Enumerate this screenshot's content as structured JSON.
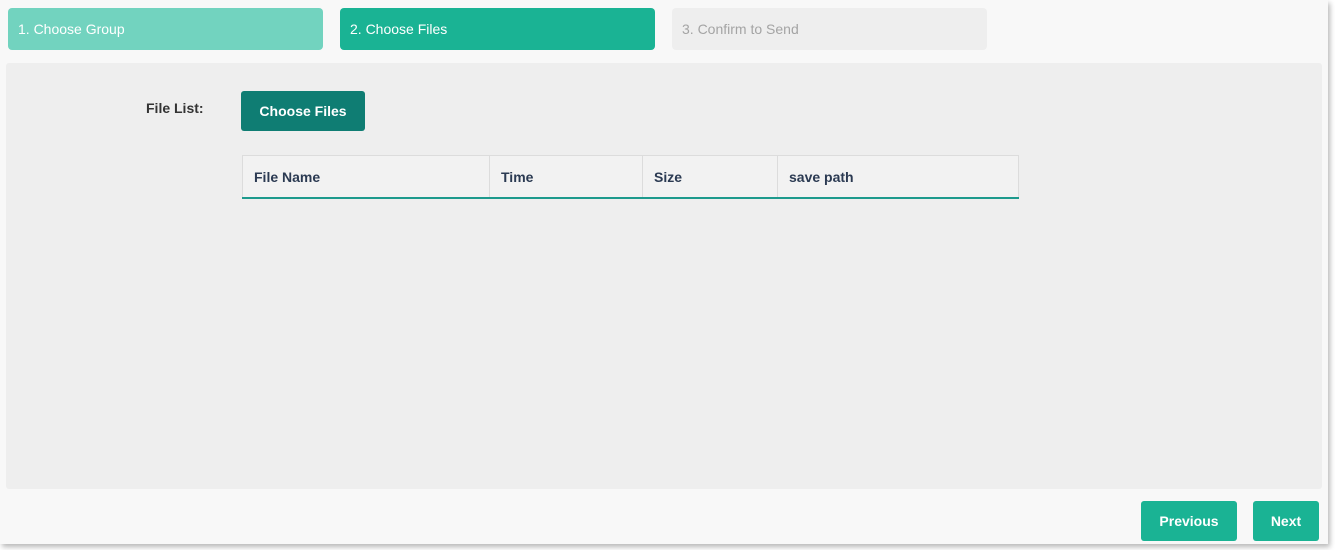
{
  "steps": [
    {
      "label": "1. Choose Group",
      "state": "done"
    },
    {
      "label": "2. Choose Files",
      "state": "active"
    },
    {
      "label": "3. Confirm to Send",
      "state": "pending"
    }
  ],
  "form": {
    "file_list_label": "File List:",
    "choose_files_label": "Choose Files"
  },
  "table": {
    "columns": [
      "File Name",
      "Time",
      "Size",
      "save path"
    ],
    "rows": []
  },
  "footer": {
    "previous_label": "Previous",
    "next_label": "Next"
  },
  "colors": {
    "step_done": "#72d3bf",
    "step_active": "#1ab394",
    "step_pending": "#eeeeee",
    "choose_files_button": "#0f7d73",
    "nav_buttons": "#1ab394"
  }
}
